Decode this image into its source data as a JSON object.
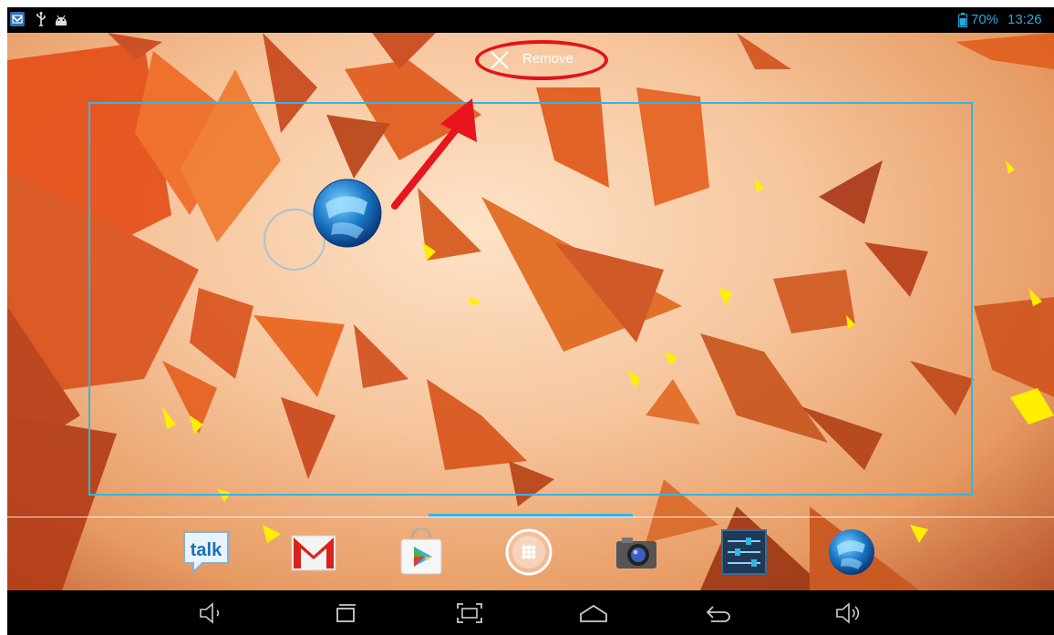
{
  "status_bar": {
    "battery_percent": "70%",
    "time": "13:26",
    "notification_icons": [
      "email-notification-icon",
      "usb-icon",
      "android-debug-icon"
    ],
    "text_color": "#2aa8e0"
  },
  "remove_target": {
    "label": "Remove",
    "icon": "close-icon",
    "highlight_color": "#e0141e"
  },
  "drop_frame_color": "#33b5e5",
  "dragged_item": {
    "icon": "globe-browser-icon"
  },
  "dock": {
    "apps": [
      {
        "name": "talk",
        "icon": "talk-icon",
        "label": "talk"
      },
      {
        "name": "gmail",
        "icon": "gmail-icon"
      },
      {
        "name": "play-store",
        "icon": "play-store-icon"
      },
      {
        "name": "all-apps",
        "icon": "all-apps-icon"
      },
      {
        "name": "camera",
        "icon": "camera-icon"
      },
      {
        "name": "settings",
        "icon": "settings-icon"
      },
      {
        "name": "browser",
        "icon": "globe-browser-icon"
      }
    ]
  },
  "nav_bar": {
    "buttons": [
      "volume-down-icon",
      "recent-apps-icon",
      "screenshot-icon",
      "home-icon",
      "back-icon",
      "volume-up-icon"
    ]
  }
}
